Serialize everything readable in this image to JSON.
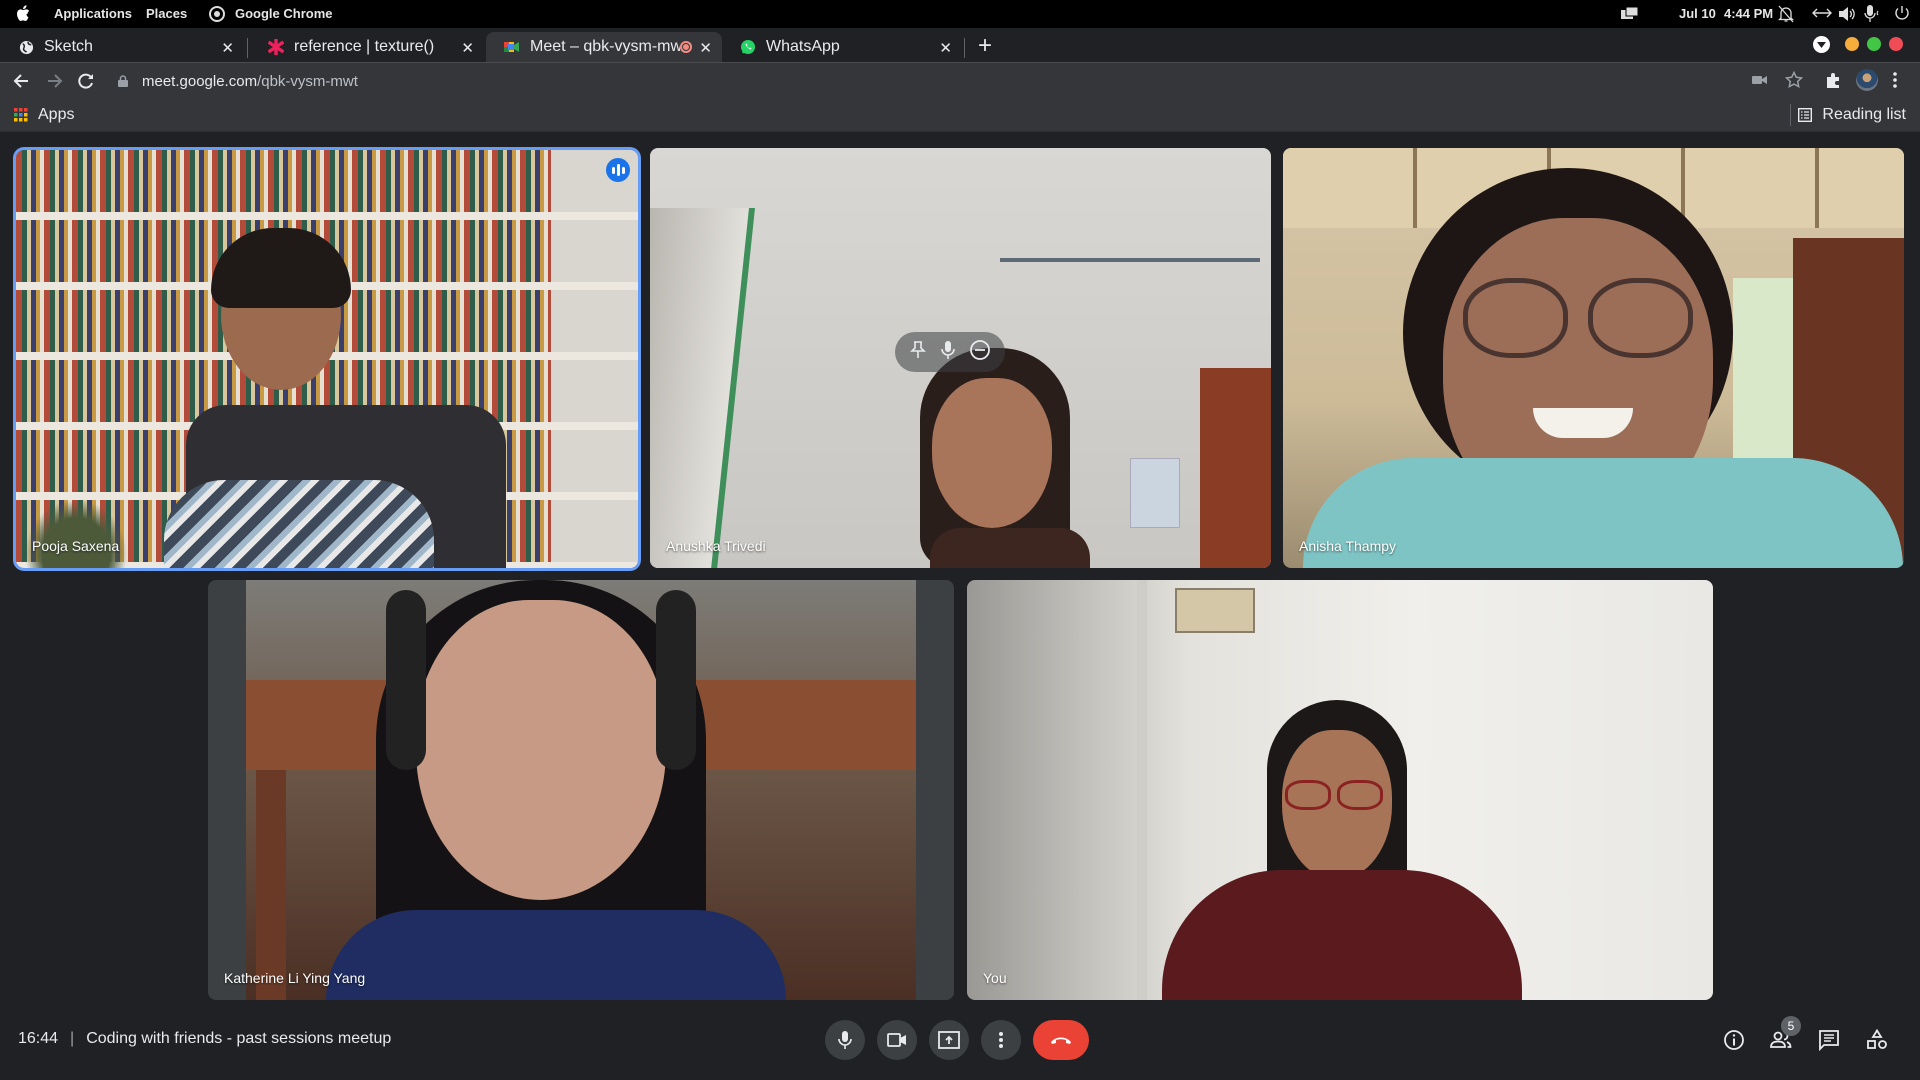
{
  "os_bar": {
    "menu_items": [
      "Applications",
      "Places",
      "Google Chrome"
    ],
    "date": "Jul 10",
    "time": "4:44 PM",
    "status_icons": [
      "screen-share-icon",
      "notifications-off-icon",
      "network-icon",
      "volume-icon",
      "microphone-icon",
      "power-icon"
    ]
  },
  "browser": {
    "tabs": [
      {
        "title": "Sketch",
        "favicon": "sketch-globe-icon",
        "active": false
      },
      {
        "title": "reference | texture()",
        "favicon": "p5-asterisk-icon",
        "active": false
      },
      {
        "title": "Meet – qbk-vysm-mwt",
        "favicon": "google-meet-icon",
        "active": true,
        "recording": true
      },
      {
        "title": "WhatsApp",
        "favicon": "whatsapp-icon",
        "active": false
      }
    ],
    "new_tab_label": "+",
    "url_host": "meet.google.com",
    "url_path": "/qbk-vysm-mwt",
    "bookmarks": {
      "apps_label": "Apps",
      "reading_list_label": "Reading list"
    },
    "window_controls_colors": {
      "minimize": "#f6ad3c",
      "maximize": "#43c645",
      "close": "#ef4c56"
    }
  },
  "meet": {
    "participants": [
      {
        "name": "Pooja Saxena",
        "speaking": true
      },
      {
        "name": "Anushka Trivedi",
        "speaking": false,
        "hover_controls": [
          "pin-icon",
          "microphone-icon",
          "remove-icon"
        ]
      },
      {
        "name": "Anisha Thampy",
        "speaking": false
      },
      {
        "name": "Katherine Li Ying Yang",
        "speaking": false
      },
      {
        "name": "You",
        "speaking": false
      }
    ],
    "bottom_bar": {
      "clock": "16:44",
      "separator": "|",
      "meeting_title": "Coding with friends - past sessions meetup",
      "controls": [
        "microphone-button",
        "camera-button",
        "present-button",
        "more-options-button",
        "end-call-button"
      ],
      "people_count": "5",
      "right_controls": [
        "meeting-details",
        "people",
        "chat",
        "activities"
      ]
    },
    "accent_color": "#1a73e8",
    "end_call_color": "#ea4335"
  }
}
